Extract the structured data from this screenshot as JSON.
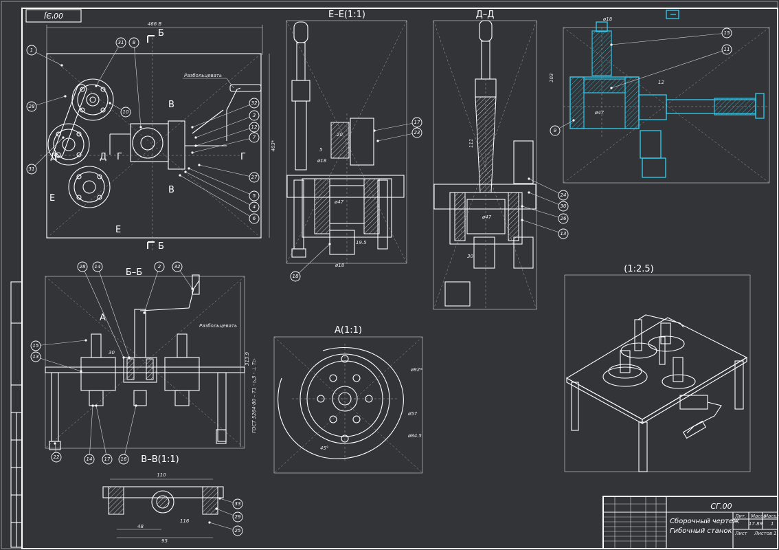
{
  "sheet": {
    "code_rotated": "00'ЭJ",
    "colors": {
      "background": "#333438",
      "lines": "#ffffff",
      "highlight": "#2fc6e8"
    }
  },
  "views": {
    "top": {
      "dim_width": "466 В",
      "dim_height": "403*",
      "note": "Разбольцевать",
      "marks": {
        "d": "Д",
        "g": "Г",
        "b": "Б",
        "v": "В",
        "e": "Е"
      }
    },
    "section_e": {
      "title": "Е–Е(1:1)",
      "dims": [
        "20",
        "5",
        "ø18",
        "ø47",
        "19.5",
        "ø18"
      ]
    },
    "section_d": {
      "title": "Д–Д",
      "dims": [
        "111",
        "ø47",
        "30"
      ]
    },
    "detail": {
      "dims": [
        "ø18",
        "ø47",
        "103",
        "12"
      ]
    },
    "section_b": {
      "title": "Б–Б",
      "dims": [
        "313.9",
        "30"
      ],
      "gost": "ГОСТ 5264-80 – Т1 - ◺5 - ⊥ Т▷",
      "note": "Разбольцевать",
      "mark_a": "А"
    },
    "section_v": {
      "title": "В–В(1:1)",
      "dims": [
        "110",
        "48",
        "95",
        "116"
      ]
    },
    "view_a": {
      "title": "А(1:1)",
      "dims": [
        "ø92*",
        "ø57",
        "ø84.5",
        "45°"
      ]
    },
    "isometric": {
      "title": "(1:2.5)"
    }
  },
  "balloons": [
    {
      "label": "1"
    },
    {
      "label": "31"
    },
    {
      "label": "8"
    },
    {
      "label": "28"
    },
    {
      "label": "10"
    },
    {
      "label": "31"
    },
    {
      "label": "32"
    },
    {
      "label": "3"
    },
    {
      "label": "12"
    },
    {
      "label": "7"
    },
    {
      "label": "27"
    },
    {
      "label": "5"
    },
    {
      "label": "4"
    },
    {
      "label": "6"
    },
    {
      "label": "17"
    },
    {
      "label": "23"
    },
    {
      "label": "18"
    },
    {
      "label": "24"
    },
    {
      "label": "30"
    },
    {
      "label": "26"
    },
    {
      "label": "13"
    },
    {
      "label": "15"
    },
    {
      "label": "11"
    },
    {
      "label": "9"
    },
    {
      "label": "28"
    },
    {
      "label": "14"
    },
    {
      "label": "2"
    },
    {
      "label": "32"
    },
    {
      "label": "15"
    },
    {
      "label": "13"
    },
    {
      "label": "22"
    },
    {
      "label": "14"
    },
    {
      "label": "17"
    },
    {
      "label": "16"
    },
    {
      "label": "33"
    },
    {
      "label": "29"
    },
    {
      "label": "25"
    }
  ],
  "title_block": {
    "doc_code": "СГ.00",
    "name_line1": "Сборочный чертеж",
    "name_line2": "Гибочный станок",
    "col_lit": "Лит.",
    "col_mass": "Масса",
    "col_scale": "Масштаб",
    "mass": "17.89",
    "scale": "1",
    "sheet_label": "Лист",
    "sheets_label": "Листов",
    "sheets_count": "1"
  }
}
